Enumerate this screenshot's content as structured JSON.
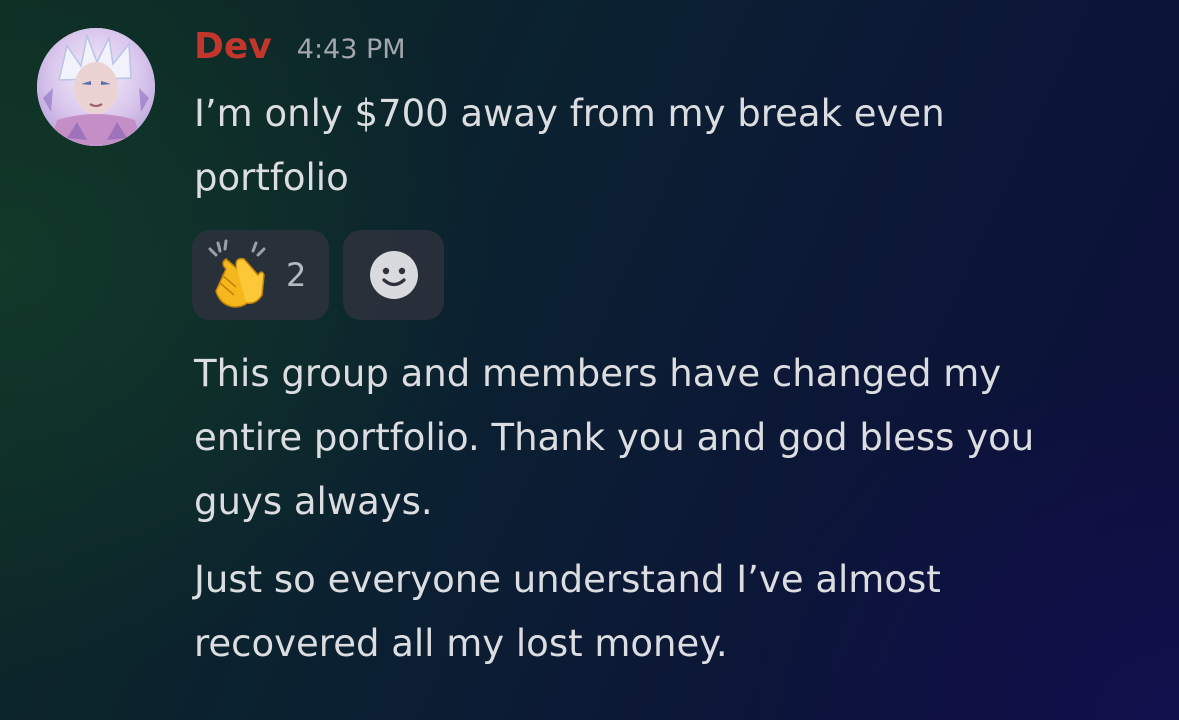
{
  "message": {
    "author": "Dev",
    "timestamp": "4:43 PM",
    "author_color": "#c2362c",
    "lines": [
      "I’m only $700 away from my break even\nportfolio",
      "This group and members have changed my\nentire portfolio. Thank you and god bless you\nguys always.",
      "Just so everyone understand I’ve almost\nrecovered all my lost money."
    ]
  },
  "reactions": [
    {
      "icon": "clapping-hands-emoji",
      "count": "2"
    },
    {
      "icon": "add-reaction-smiley-icon"
    }
  ]
}
